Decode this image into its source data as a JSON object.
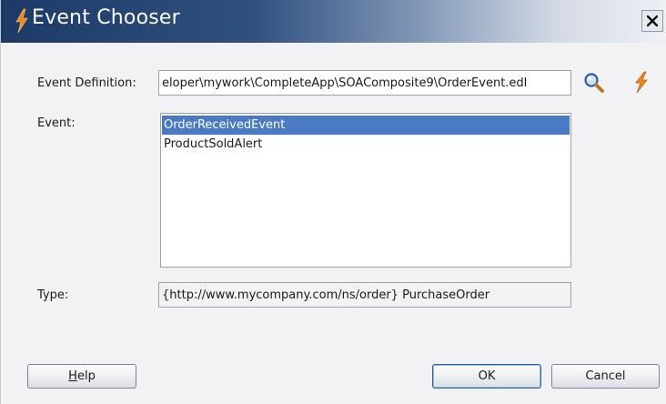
{
  "dialog": {
    "title": "Event Chooser"
  },
  "form": {
    "event_definition_label": "Event Definition:",
    "event_definition_value": "eloper\\mywork\\CompleteApp\\SOAComposite9\\OrderEvent.edl",
    "event_label": "Event:",
    "events": [
      {
        "label": "OrderReceivedEvent",
        "selected": true
      },
      {
        "label": "ProductSoldAlert",
        "selected": false
      }
    ],
    "type_label": "Type:",
    "type_value": "{http://www.mycompany.com/ns/order} PurchaseOrder"
  },
  "buttons": {
    "help_mnemonic": "H",
    "help_rest": "elp",
    "ok": "OK",
    "cancel": "Cancel"
  },
  "icons": {
    "title_icon": "lightning-bolt-icon",
    "browse": "search-icon",
    "create_event": "lightning-bolt-icon",
    "close": "close-icon"
  },
  "colors": {
    "selection": "#4a79c6",
    "title_bar": "#1d3a67",
    "bolt": "#f08a1c"
  }
}
